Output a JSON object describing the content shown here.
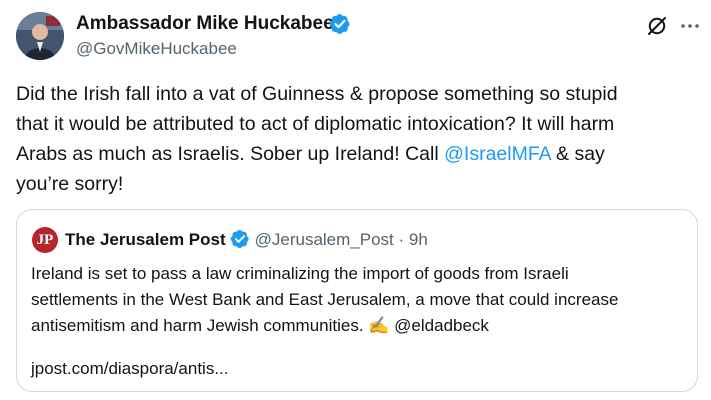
{
  "author": {
    "name": "Ambassador Mike Huckabee",
    "handle": "@GovMikeHuckabee"
  },
  "icons": {
    "verified": "verified-badge-icon",
    "grok": "grok-icon",
    "more": "more-icon"
  },
  "tweet": {
    "line1": "Did the Irish fall into a vat of Guinness & propose something so stupid",
    "line2": "that it would be attributed to act of diplomatic intoxication?  It will harm",
    "line3": "Arabs as much as Israelis.  Sober up Ireland! Call ",
    "mention": "@IsraelMFA",
    "line3_end": " & say",
    "line4": "you’re sorry!"
  },
  "quote": {
    "logo_text": "JP",
    "name": "The Jerusalem Post",
    "handle": "@Jerusalem_Post",
    "separator": " · ",
    "time": "9h",
    "line1": "Ireland is set to pass a law criminalizing the import of goods from Israeli",
    "line2": "settlements in the West Bank and East Jerusalem, a move that could increase",
    "line3": "antisemitism and harm Jewish communities. ✍️ @eldadbeck",
    "link": "jpost.com/diaspora/antis..."
  },
  "colors": {
    "verified_blue": "#1d9bf0",
    "link_blue": "#1d9bf0",
    "secondary_text": "#536471",
    "jpost_red": "#b5262c",
    "border": "#cfd9de"
  }
}
